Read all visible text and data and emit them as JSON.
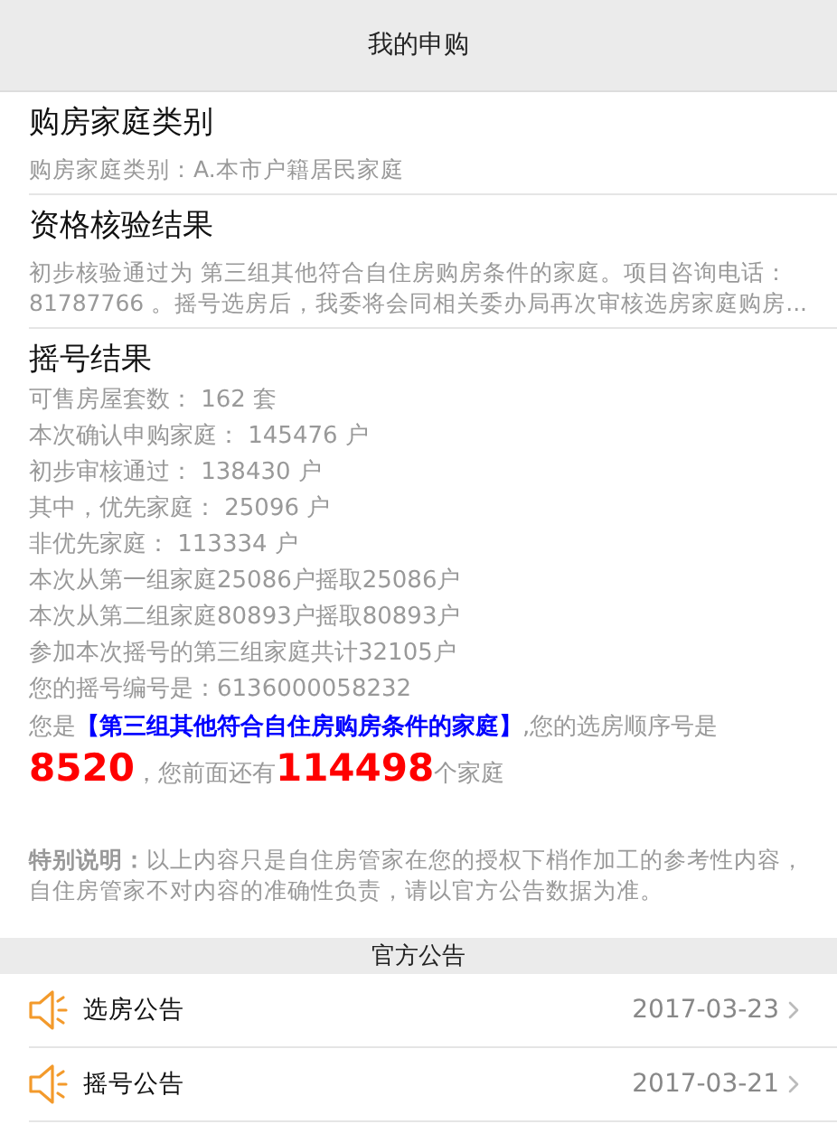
{
  "header": {
    "title": "我的申购"
  },
  "category": {
    "title": "购房家庭类别",
    "text": "购房家庭类别：A.本市户籍居民家庭"
  },
  "qualification": {
    "title": "资格核验结果",
    "text": "初步核验通过为 第三组其他符合自住房购房条件的家庭。项目咨询电话：81787766 。摇号选房后，我委将会同相关委办局再次审核选房家庭购房..."
  },
  "lottery": {
    "title": "摇号结果",
    "lines": [
      "可售房屋套数： 162 套",
      "本次确认申购家庭： 145476 户",
      "初步审核通过： 138430 户",
      "其中，优先家庭： 25096 户",
      "非优先家庭： 113334 户",
      "本次从第一组家庭25086户摇取25086户",
      "本次从第二组家庭80893户摇取80893户",
      "参加本次摇号的第三组家庭共计32105户",
      "您的摇号编号是：6136000058232"
    ],
    "result": {
      "prefix": "您是",
      "group": "【第三组其他符合自住房购房条件的家庭】",
      "middle": ",您的选房顺序号是",
      "order": "8520",
      "middle2": "，您前面还有",
      "ahead": "114498",
      "suffix": "个家庭"
    }
  },
  "note": {
    "label": "特别说明：",
    "text": "以上内容只是自住房管家在您的授权下梢作加工的参考性内容，自住房管家不对内容的准确性负责，请以官方公告数据为准。"
  },
  "announcements": {
    "title": "官方公告",
    "items": [
      {
        "title": "选房公告",
        "date": "2017-03-23"
      },
      {
        "title": "摇号公告",
        "date": "2017-03-21"
      }
    ]
  }
}
